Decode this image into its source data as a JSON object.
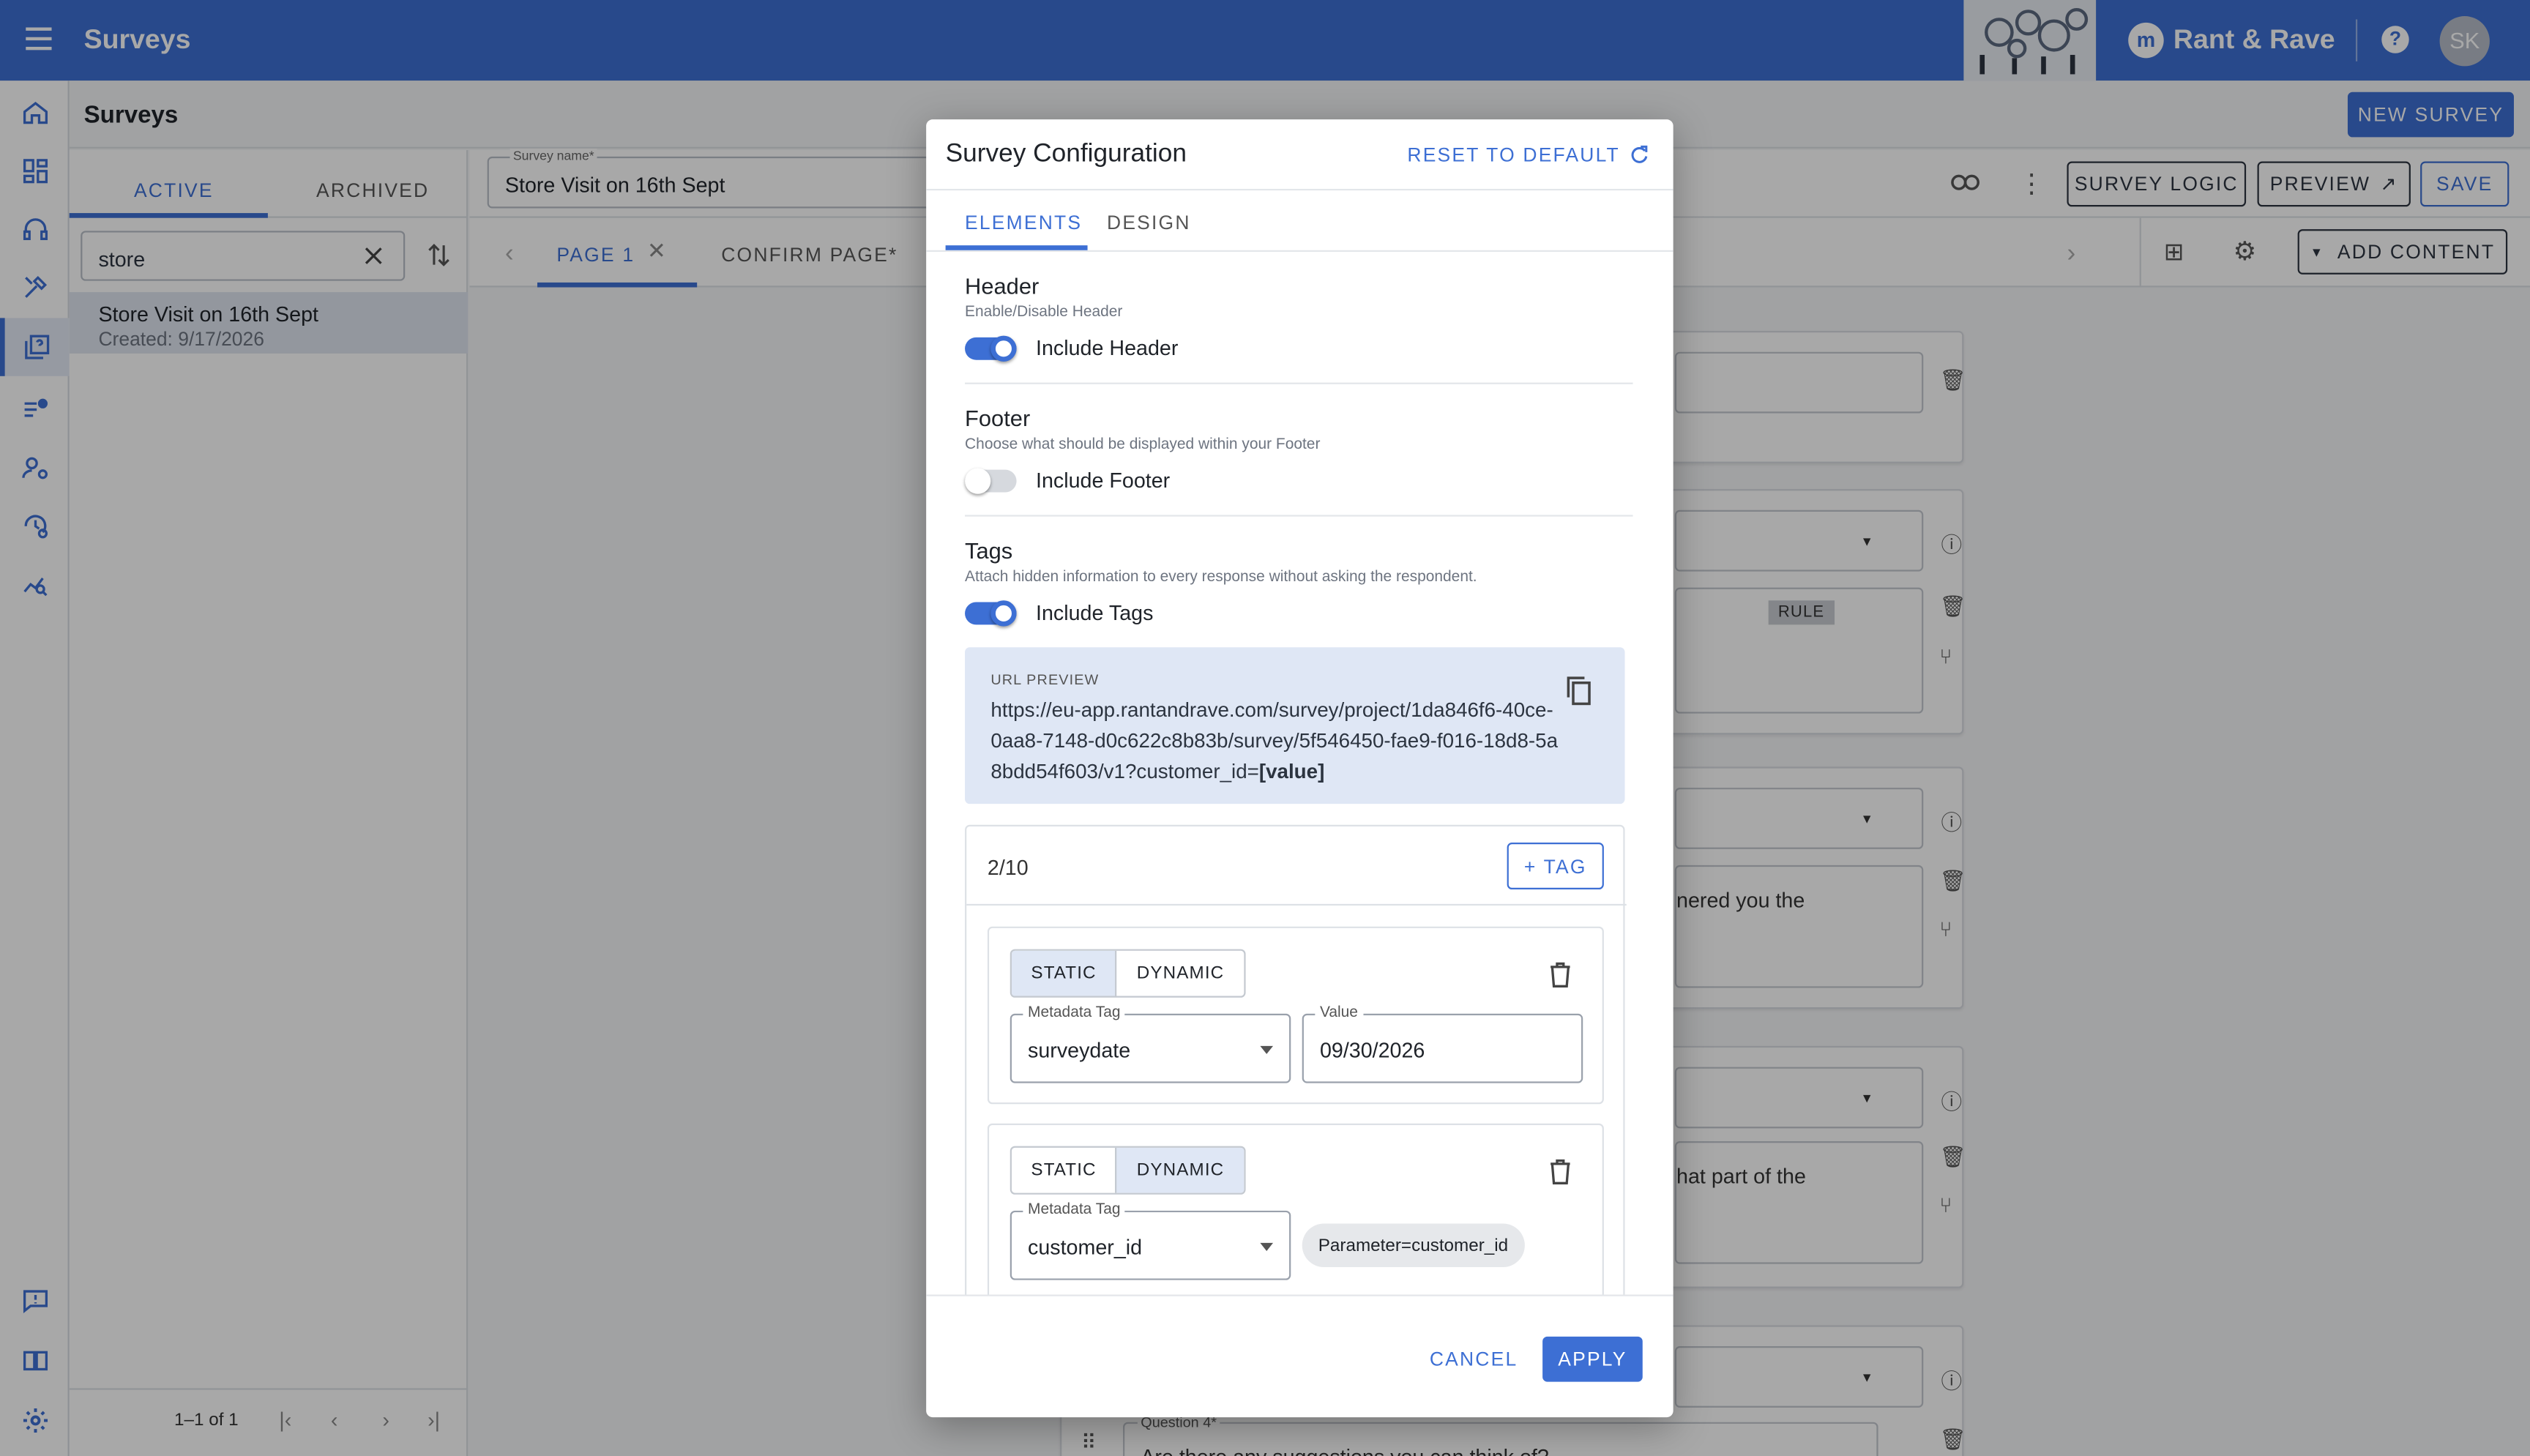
{
  "topbar": {
    "title": "Surveys",
    "brand": "Rant & Rave",
    "avatar": "SK"
  },
  "nav": {
    "icons": [
      "home-icon",
      "dashboard-icon",
      "headset-icon",
      "tools-icon",
      "surveys-icon",
      "tasks-icon",
      "users-settings-icon",
      "history-settings-icon",
      "analytics-icon",
      "feedback-icon",
      "compare-icon",
      "settings-icon"
    ]
  },
  "page": {
    "title": "Surveys",
    "new_survey": "NEW SURVEY",
    "tabs": [
      "ACTIVE",
      "ARCHIVED"
    ],
    "search_value": "store",
    "list": [
      {
        "name": "Store Visit on 16th Sept",
        "created": "Created: 9/17/2026"
      }
    ],
    "pager": "1–1 of 1"
  },
  "editor": {
    "name_label": "Survey name*",
    "name_value": "Store Visit on 16th Sept",
    "survey_logic": "SURVEY LOGIC",
    "preview": "PREVIEW",
    "save": "SAVE",
    "pages": [
      "PAGE 1",
      "CONFIRM PAGE*"
    ],
    "add_content": "ADD CONTENT",
    "rule_badge": "RULE",
    "snippet_1": "nered you the",
    "snippet_2": "hat part of the",
    "question4_label": "Question 4*",
    "question4_text": "Are there any suggestions you can think of?"
  },
  "modal": {
    "title": "Survey Configuration",
    "reset": "RESET TO DEFAULT",
    "tabs": [
      "ELEMENTS",
      "DESIGN"
    ],
    "header": {
      "title": "Header",
      "sub": "Enable/Disable Header",
      "toggle_label": "Include Header",
      "on": true
    },
    "footer": {
      "title": "Footer",
      "sub": "Choose what should be displayed within your Footer",
      "toggle_label": "Include Footer",
      "on": false
    },
    "tags": {
      "title": "Tags",
      "sub": "Attach hidden information to every response without asking the respondent.",
      "toggle_label": "Include Tags",
      "on": true,
      "url_label": "URL PREVIEW",
      "url_text": "https://eu-app.rantandrave.com/survey/project/1da846f6-40ce-0aa8-7148-d0c622c8b83b/survey/5f546450-fae9-f016-18d8-5a8bdd54f603/v1?customer_id=",
      "url_value": "[value]",
      "count": "2/10",
      "add_tag": "+ TAG",
      "items": [
        {
          "seg": [
            "STATIC",
            "DYNAMIC"
          ],
          "selected": "STATIC",
          "tag_label": "Metadata Tag",
          "tag_value": "surveydate",
          "value_label": "Value",
          "value": "09/30/2026"
        },
        {
          "seg": [
            "STATIC",
            "DYNAMIC"
          ],
          "selected": "DYNAMIC",
          "tag_label": "Metadata Tag",
          "tag_value": "customer_id",
          "chip": "Parameter=customer_id"
        }
      ]
    },
    "cancel": "CANCEL",
    "apply": "APPLY"
  }
}
